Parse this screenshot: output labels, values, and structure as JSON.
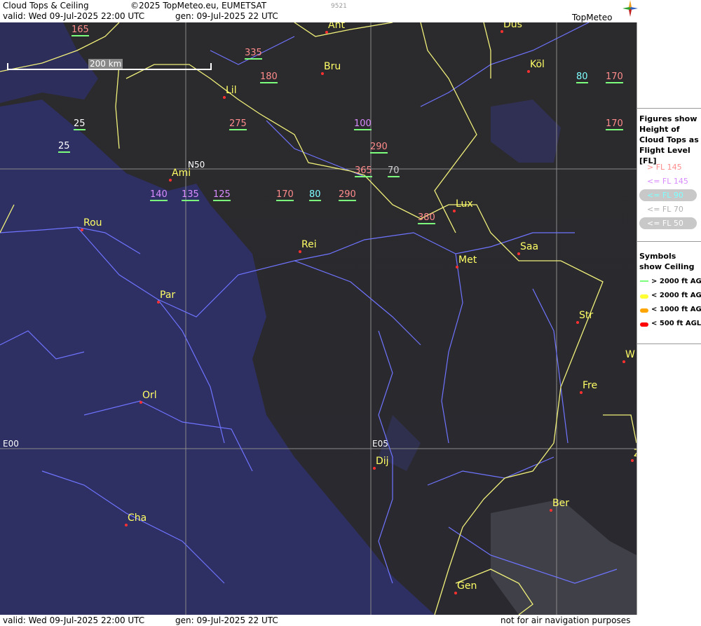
{
  "header": {
    "title": "Cloud Tops & Ceiling",
    "copyright": "©2025 TopMeteo.eu, EUMETSAT",
    "code": "9521",
    "valid": "valid:  Wed  09-Jul-2025  22:00 UTC",
    "gen": "gen: 09-Jul-2025 22 UTC",
    "logo": "TopMeteo"
  },
  "footer": {
    "valid": "valid:  Wed  09-Jul-2025  22:00 UTC",
    "gen": "gen: 09-Jul-2025 22 UTC",
    "note": "not for air navigation purposes"
  },
  "scale": "200 km",
  "grid_labels": {
    "lat": "N50",
    "lon0": "E00",
    "lon5": "E05"
  },
  "cities": [
    {
      "name": "Ant"
    },
    {
      "name": "Düs"
    },
    {
      "name": "Köl"
    },
    {
      "name": "Bru"
    },
    {
      "name": "Lil"
    },
    {
      "name": "Ami"
    },
    {
      "name": "Rou"
    },
    {
      "name": "Rei"
    },
    {
      "name": "Lux"
    },
    {
      "name": "Met"
    },
    {
      "name": "Saa"
    },
    {
      "name": "Par"
    },
    {
      "name": "Str"
    },
    {
      "name": "W"
    },
    {
      "name": "Fre"
    },
    {
      "name": "Orl"
    },
    {
      "name": "Dij"
    },
    {
      "name": "Ber"
    },
    {
      "name": "Cha"
    },
    {
      "name": "Gen"
    },
    {
      "name": "Z"
    }
  ],
  "levels": [
    {
      "v": "165",
      "c": "#ff8c8c"
    },
    {
      "v": "335",
      "c": "#ff8c8c"
    },
    {
      "v": "180",
      "c": "#ff8c8c"
    },
    {
      "v": "80",
      "c": "#7fffff"
    },
    {
      "v": "170",
      "c": "#ff8c8c"
    },
    {
      "v": "275",
      "c": "#ff8c8c"
    },
    {
      "v": "25",
      "c": "#ffffff"
    },
    {
      "v": "25",
      "c": "#ffffff"
    },
    {
      "v": "100",
      "c": "#d88cff"
    },
    {
      "v": "170",
      "c": "#ff8c8c"
    },
    {
      "v": "290",
      "c": "#ff8c8c"
    },
    {
      "v": "365",
      "c": "#ff8c8c"
    },
    {
      "v": "70",
      "c": "#d0d0d0"
    },
    {
      "v": "140",
      "c": "#d88cff"
    },
    {
      "v": "135",
      "c": "#d88cff"
    },
    {
      "v": "125",
      "c": "#d88cff"
    },
    {
      "v": "170",
      "c": "#ff8c8c"
    },
    {
      "v": "80",
      "c": "#7fffff"
    },
    {
      "v": "290",
      "c": "#ff8c8c"
    },
    {
      "v": "380",
      "c": "#ff8c8c"
    }
  ],
  "legend": {
    "figures_title": "Figures show Height of Cloud Tops as Flight Level  [FL]",
    "fl": [
      {
        "label": "> FL 145",
        "color": "#ff8c8c"
      },
      {
        "label": "<= FL 145",
        "color": "#d88cff"
      },
      {
        "label": "<= FL 90",
        "color": "#7fffff"
      },
      {
        "label": "<= FL 70",
        "color": "#b0b0b0"
      },
      {
        "label": "<= FL 50",
        "color": "#ffffff"
      }
    ],
    "symbols_title": "Symbols show Ceiling",
    "ceiling": [
      {
        "label": "> 2000 ft AGL",
        "color": "#7cff7c"
      },
      {
        "label": "< 2000 ft AGL",
        "color": "#ffff33"
      },
      {
        "label": "< 1000 ft AGL",
        "color": "#ffa500"
      },
      {
        "label": "< 500 ft AGL",
        "color": "#ff0000"
      }
    ]
  },
  "colors": {
    "map_dark": "#2b2a2c",
    "map_blue": "#2f2f6a",
    "border": "#f0f07a",
    "river": "#6f74ff"
  }
}
